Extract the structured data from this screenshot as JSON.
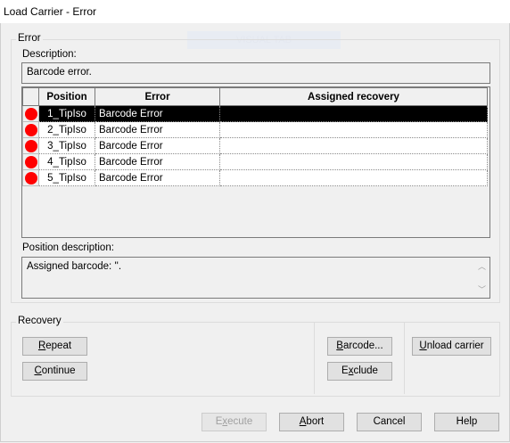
{
  "window": {
    "title": "Load Carrier - Error"
  },
  "ghost_text": "VISUAL TAB",
  "error_group": {
    "label": "Error",
    "description_label": "Description:",
    "description_value": "Barcode error.",
    "columns": [
      "Position",
      "Error",
      "Assigned recovery"
    ],
    "rows": [
      {
        "position": "1_TipIso",
        "error": "Barcode Error",
        "recovery": "",
        "status_color": "#ff0000",
        "selected": true
      },
      {
        "position": "2_TipIso",
        "error": "Barcode Error",
        "recovery": "",
        "status_color": "#ff0000",
        "selected": false
      },
      {
        "position": "3_TipIso",
        "error": "Barcode Error",
        "recovery": "",
        "status_color": "#ff0000",
        "selected": false
      },
      {
        "position": "4_TipIso",
        "error": "Barcode Error",
        "recovery": "",
        "status_color": "#ff0000",
        "selected": false
      },
      {
        "position": "5_TipIso",
        "error": "Barcode Error",
        "recovery": "",
        "status_color": "#ff0000",
        "selected": false
      }
    ],
    "position_description_label": "Position description:",
    "position_description_value": "Assigned barcode: ''."
  },
  "recovery_group": {
    "label": "Recovery",
    "buttons": {
      "repeat": {
        "pre": "",
        "mn": "R",
        "post": "epeat"
      },
      "continue": {
        "pre": "",
        "mn": "C",
        "post": "ontinue"
      },
      "barcode": {
        "pre": "",
        "mn": "B",
        "post": "arcode..."
      },
      "exclude": {
        "pre": "E",
        "mn": "x",
        "post": "clude"
      },
      "unload": {
        "pre": "",
        "mn": "U",
        "post": "nload carrier"
      }
    }
  },
  "footer": {
    "execute": {
      "pre": "E",
      "mn": "x",
      "post": "ecute"
    },
    "abort": {
      "pre": "",
      "mn": "A",
      "post": "bort"
    },
    "cancel": "Cancel",
    "help": "Help"
  },
  "icons": {
    "status": "error-dot-icon",
    "scroll_up": "scroll-up-icon",
    "scroll_down": "scroll-down-icon"
  }
}
